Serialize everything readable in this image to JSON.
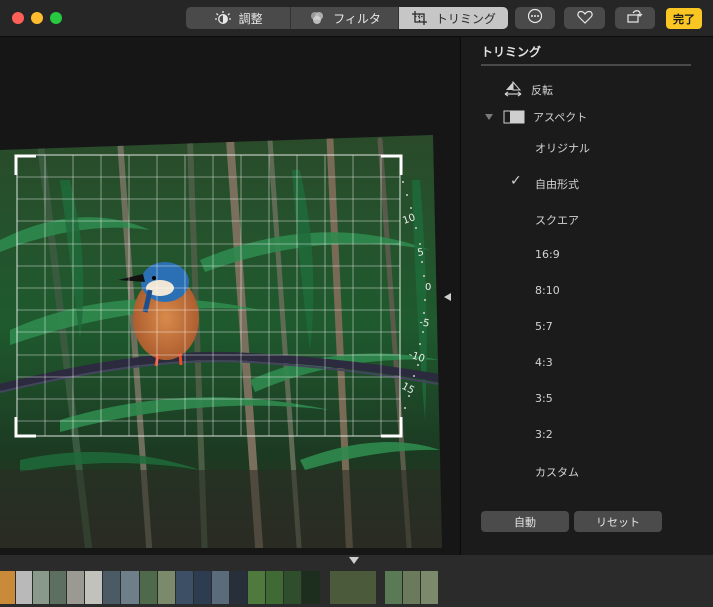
{
  "toolbar": {
    "adjust_label": "調整",
    "filter_label": "フィルタ",
    "crop_label": "トリミング",
    "done_label": "完了"
  },
  "sidebar": {
    "title": "トリミング",
    "flip_label": "反転",
    "aspect_label": "アスペクト",
    "options": [
      "オリジナル",
      "自由形式",
      "スクエア",
      "16:9",
      "8:10",
      "5:7",
      "4:3",
      "3:5",
      "3:2",
      "カスタム"
    ],
    "selected_option": "自由形式",
    "auto_label": "自動",
    "reset_label": "リセット"
  },
  "dial": {
    "ticks": [
      "10",
      "5",
      "0",
      "-5",
      "-10",
      "15"
    ]
  },
  "colors": {
    "accent_done": "#f9c623",
    "traffic_red": "#fe5f57",
    "traffic_yellow": "#febc2e",
    "traffic_green": "#28c840"
  }
}
